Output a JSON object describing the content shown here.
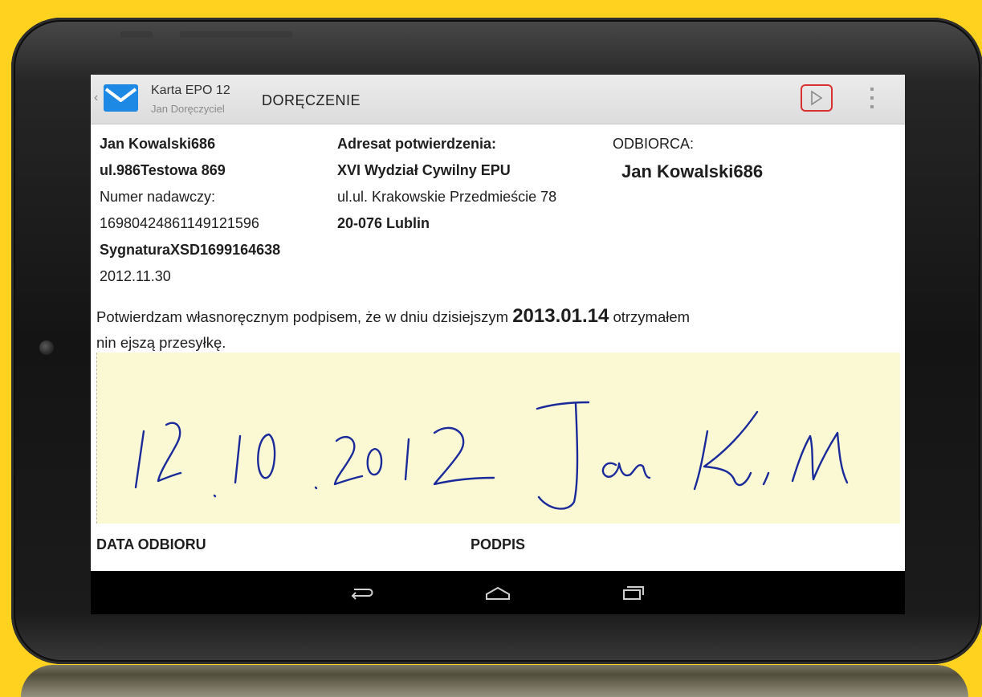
{
  "action_bar": {
    "card_title": "Karta EPO 12",
    "card_subtitle": "Jan Doręczyciel",
    "section_title": "DORĘCZENIE",
    "up_caret": "‹",
    "send_icon": "play-icon",
    "overflow_icon": "overflow-menu-icon"
  },
  "sender": {
    "name": "Jan Kowalski686",
    "street": "ul.986Testowa 869",
    "tracking_label": "Numer nadawczy:",
    "tracking_number": "169804248611491215​96",
    "signature_ref": "SygnaturaXSD1699164638",
    "date": "2012.11.30"
  },
  "confirmation_addressee": {
    "label": "Adresat potwierdzenia:",
    "name": "XVI Wydział Cywilny EPU",
    "street": "ul.ul. Krakowskie Przedmieście 78",
    "city": "20-076 Lublin"
  },
  "recipient": {
    "label": "ODBIORCA:",
    "name": "Jan Kowalski686"
  },
  "statement": {
    "part1": "Potwierdzam własnoręcznym podpisem, że w dniu dzisiejszym ",
    "date": "2013.01.14",
    "part2": " otrzymałem",
    "line2": "nin ejszą przesyłkę."
  },
  "signature_area": {
    "handwritten": "12.10.2012 Jan K.M",
    "ink_color": "#1a2a9a",
    "background_color": "#fbf9d3"
  },
  "footer_labels": {
    "date_label": "DATA ODBIORU",
    "signature_label": "PODPIS"
  },
  "nav": {
    "back_icon": "back-icon",
    "home_icon": "home-icon",
    "recents_icon": "recent-apps-icon"
  },
  "colors": {
    "frame_background": "#ffd21f",
    "accent_red": "#d93030",
    "icon_blue": "#1e88e5"
  }
}
